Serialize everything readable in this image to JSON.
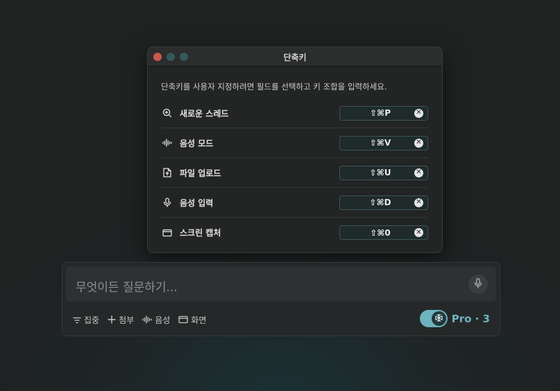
{
  "dialog": {
    "title": "단축키",
    "description": "단축키를 사용자 지정하려면 필드를 선택하고 키 조합을 입력하세요.",
    "clear_symbol": "✕",
    "shortcuts": [
      {
        "icon": "new-thread-icon",
        "label": "새로운 스레드",
        "keys": "⇧⌘P"
      },
      {
        "icon": "voice-mode-icon",
        "label": "음성 모드",
        "keys": "⇧⌘V"
      },
      {
        "icon": "file-upload-icon",
        "label": "파일 업로드",
        "keys": "⇧⌘U"
      },
      {
        "icon": "microphone-icon",
        "label": "음성 입력",
        "keys": "⇧⌘D"
      },
      {
        "icon": "screen-capture-icon",
        "label": "스크린 캡처",
        "keys": "⇧⌘0"
      }
    ]
  },
  "chat": {
    "placeholder": "무엇이든 질문하기...",
    "tools": [
      {
        "icon": "focus-filter-icon",
        "label": "집중"
      },
      {
        "icon": "plus-icon",
        "label": "첨부"
      },
      {
        "icon": "voice-wave-icon",
        "label": "음성"
      },
      {
        "icon": "screen-icon",
        "label": "화면"
      }
    ],
    "pro_label": "Pro · 3",
    "pro_enabled": true
  },
  "colors": {
    "accent": "#6eb3bf",
    "close_button": "#c8574f",
    "inactive_button": "#33595b"
  }
}
